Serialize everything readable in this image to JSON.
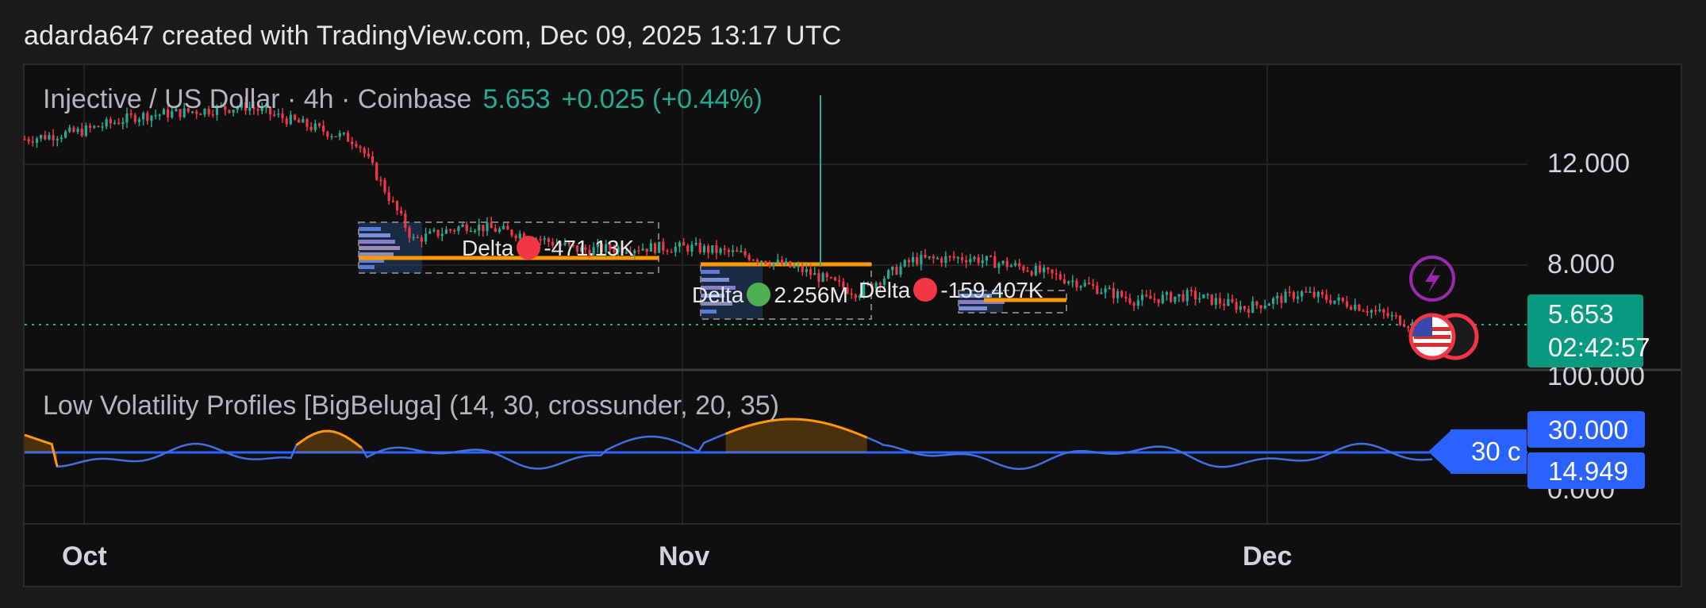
{
  "credit": "adarda647 created with TradingView.com, Dec 09, 2025 13:17 UTC",
  "symbol": {
    "title": "Injective / US Dollar · 4h · Coinbase",
    "price": "5.653",
    "change": "+0.025 (+0.44%)"
  },
  "indicator": {
    "title": "Low Volatility Profiles [BigBeluga] (14, 30, crossunder, 20, 35)",
    "level_flag": "30 c"
  },
  "price_axis": [
    "12.000",
    "8.000",
    "100.000",
    "0.000"
  ],
  "time_axis": [
    "Oct",
    "Nov",
    "Dec"
  ],
  "last_price_tag": {
    "price": "5.653",
    "countdown": "02:42:57"
  },
  "indicator_tags": [
    "30.000",
    "14.949"
  ],
  "delta_labels": [
    {
      "text_left": "Delta",
      "text_right": "-471.13K",
      "dot": "red"
    },
    {
      "text_left": "Delta",
      "text_right": "2.256M",
      "dot": "green"
    },
    {
      "text_left": "Delta",
      "text_right": "-159.407K",
      "dot": "red"
    }
  ],
  "colors": {
    "up": "#22ab94",
    "down": "#f23645",
    "profile": "#2962ff",
    "poc": "#ff9800",
    "indicator_line": "#3f6fe0",
    "threshold": "#2962ff",
    "flash_icon": "#9c27b0"
  },
  "icons": [
    "flash-icon",
    "us-flag-icon"
  ],
  "chart_data": {
    "type": "line",
    "x_ticks": [
      "Oct",
      "Nov",
      "Dec"
    ],
    "y_ticks_price": [
      "12.000",
      "8.000"
    ],
    "price": {
      "x": [
        0,
        4,
        8,
        12,
        16,
        20,
        24,
        28,
        32,
        36,
        40,
        44,
        48,
        52,
        56,
        60,
        64,
        68,
        72,
        76,
        80,
        84,
        88,
        92,
        96,
        100
      ],
      "y": [
        13.0,
        13.3,
        13.9,
        14.1,
        14.3,
        13.6,
        12.9,
        9.0,
        9.6,
        9.2,
        8.6,
        8.7,
        8.7,
        8.4,
        7.8,
        6.9,
        8.2,
        8.3,
        7.9,
        7.3,
        6.6,
        6.8,
        6.3,
        6.9,
        6.4,
        5.65
      ]
    },
    "last_price": 5.653,
    "indicator": {
      "threshold": 30.0,
      "current": 14.949
    }
  }
}
